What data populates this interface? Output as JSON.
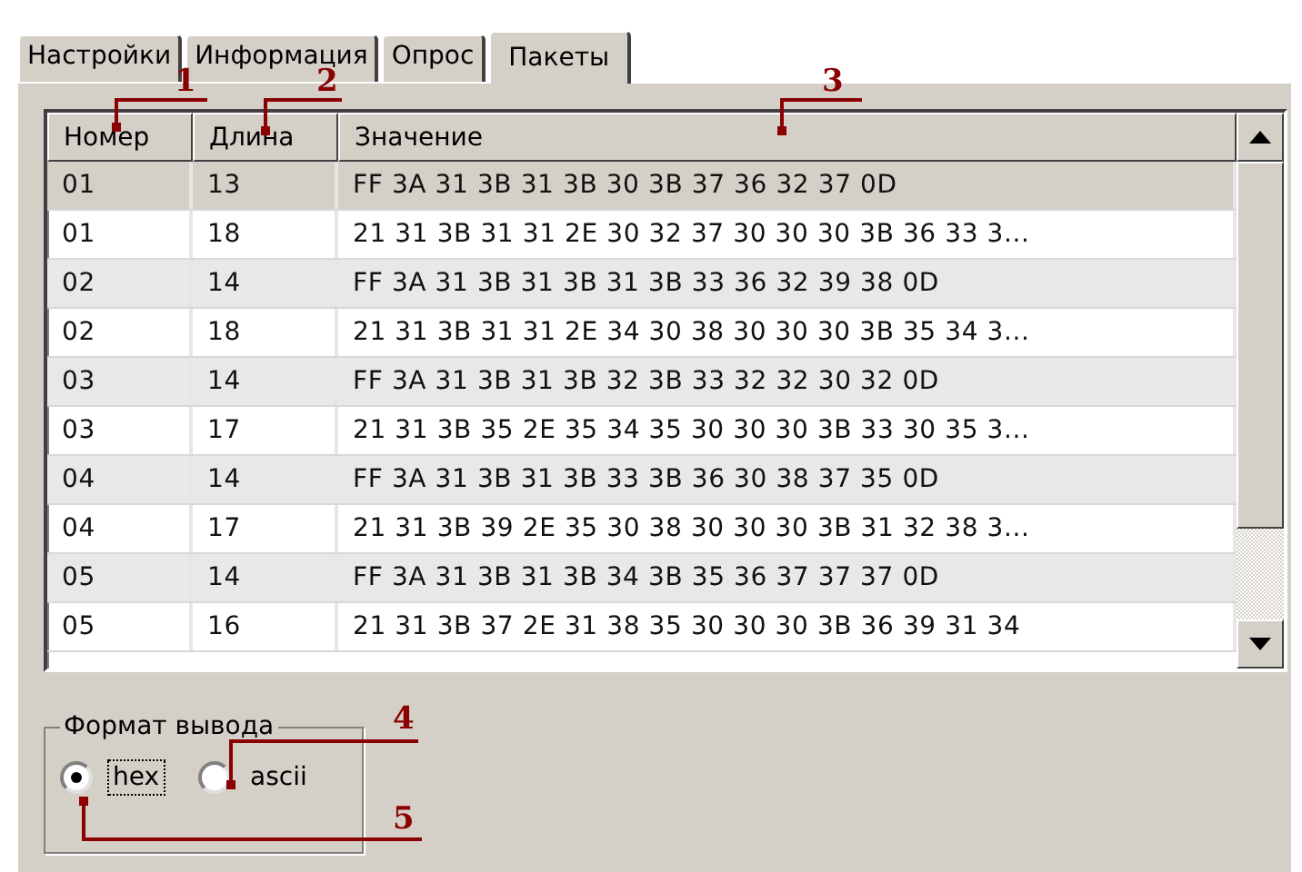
{
  "tabs": [
    {
      "label": "Настройки",
      "selected": false
    },
    {
      "label": "Информация",
      "selected": false
    },
    {
      "label": "Опрос",
      "selected": false
    },
    {
      "label": "Пакеты",
      "selected": true
    }
  ],
  "table": {
    "columns": [
      "Номер",
      "Длина",
      "Значение"
    ],
    "rows": [
      {
        "cells": [
          "01",
          "13",
          "FF 3A 31 3B 31 3B 30 3B 37 36 32 37 0D"
        ],
        "selected": true
      },
      {
        "cells": [
          "01",
          "18",
          "21 31 3B 31 31 2E 30 32 37 30 30 30 3B 36 33 3..."
        ],
        "selected": false
      },
      {
        "cells": [
          "02",
          "14",
          "FF 3A 31 3B 31 3B 31 3B 33 36 32 39 38 0D"
        ],
        "selected": false
      },
      {
        "cells": [
          "02",
          "18",
          "21 31 3B 31 31 2E 34 30 38 30 30 30 3B 35 34 3..."
        ],
        "selected": false
      },
      {
        "cells": [
          "03",
          "14",
          "FF 3A 31 3B 31 3B 32 3B 33 32 32 30 32 0D"
        ],
        "selected": false
      },
      {
        "cells": [
          "03",
          "17",
          "21 31 3B 35 2E 35 34 35 30 30 30 3B 33 30 35 3..."
        ],
        "selected": false
      },
      {
        "cells": [
          "04",
          "14",
          "FF 3A 31 3B 31 3B 33 3B 36 30 38 37 35 0D"
        ],
        "selected": false
      },
      {
        "cells": [
          "04",
          "17",
          "21 31 3B 39 2E 35 30 38 30 30 30 3B 31 32 38 3..."
        ],
        "selected": false
      },
      {
        "cells": [
          "05",
          "14",
          "FF 3A 31 3B 31 3B 34 3B 35 36 37 37 37 0D"
        ],
        "selected": false
      },
      {
        "cells": [
          "05",
          "16",
          "21 31 3B 37 2E 31 38 35 30 30 30 3B 36 39 31 34"
        ],
        "selected": false
      }
    ]
  },
  "output_format": {
    "title": "Формат вывода",
    "options": [
      {
        "label": "hex",
        "selected": true,
        "focused": true
      },
      {
        "label": "ascii",
        "selected": false,
        "focused": false
      }
    ]
  },
  "callouts": [
    {
      "label": "1"
    },
    {
      "label": "2"
    },
    {
      "label": "3"
    },
    {
      "label": "4"
    },
    {
      "label": "5"
    }
  ]
}
